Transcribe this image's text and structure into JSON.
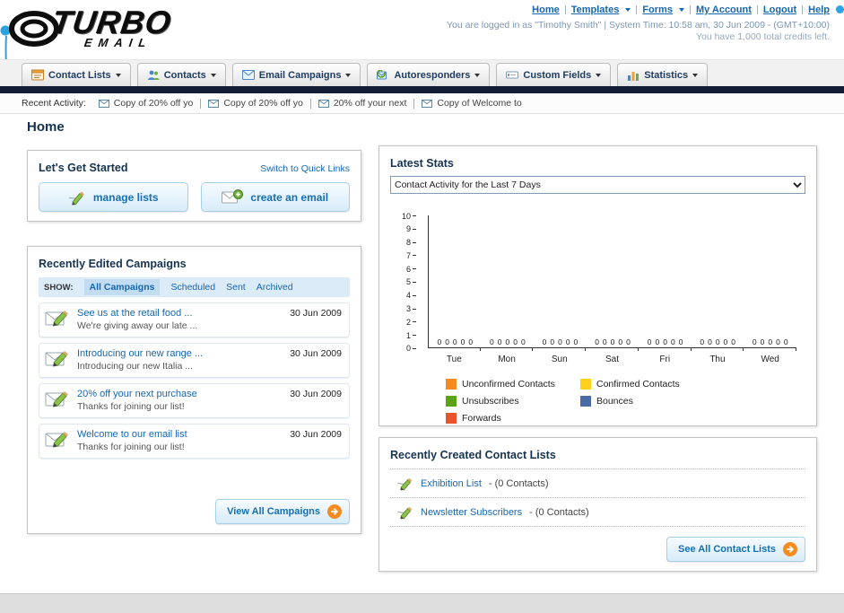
{
  "header": {
    "logo": {
      "line1": "TURBO",
      "line2": "EMAIL"
    },
    "nav": {
      "home": "Home",
      "templates": "Templates",
      "forms": "Forms",
      "my_account": "My Account",
      "logout": "Logout",
      "help": "Help"
    },
    "login_line": "You are logged in as \"Timothy Smith\" | System Time: 10:58 am, 30 Jun 2009 - (GMT+10:00)",
    "credits_line": "You have 1,000 total credits left."
  },
  "tabs": [
    {
      "label": "Contact Lists"
    },
    {
      "label": "Contacts"
    },
    {
      "label": "Email Campaigns"
    },
    {
      "label": "Autoresponders"
    },
    {
      "label": "Custom Fields"
    },
    {
      "label": "Statistics"
    }
  ],
  "recent_activity": {
    "label": "Recent Activity:",
    "items": [
      {
        "text": "Copy of 20% off yo"
      },
      {
        "text": "Copy of 20% off yo"
      },
      {
        "text": "20% off your next"
      },
      {
        "text": "Copy of Welcome to"
      }
    ]
  },
  "page_title": "Home",
  "get_started": {
    "title": "Let's Get Started",
    "switch_link": "Switch to Quick Links",
    "manage_lists": "manage lists",
    "create_email": "create an email"
  },
  "campaigns": {
    "title": "Recently Edited Campaigns",
    "show_label": "SHOW:",
    "filters": [
      {
        "label": "All Campaigns"
      },
      {
        "label": "Scheduled"
      },
      {
        "label": "Sent"
      },
      {
        "label": "Archived"
      }
    ],
    "items": [
      {
        "title": "See us at the retail food ...",
        "subtitle": "We're giving away our late ...",
        "date": "30 Jun 2009"
      },
      {
        "title": "Introducing our new range ...",
        "subtitle": "Introducing our new Italia ...",
        "date": "30 Jun 2009"
      },
      {
        "title": "20% off your next purchase",
        "subtitle": "Thanks for joining our list!",
        "date": "30 Jun 2009"
      },
      {
        "title": "Welcome to our email list",
        "subtitle": "Thanks for joining our list!",
        "date": "30 Jun 2009"
      }
    ],
    "view_all_label": "View All Campaigns"
  },
  "stats": {
    "title": "Latest Stats",
    "selector_value": "Contact Activity for the Last 7 Days"
  },
  "chart_data": {
    "type": "bar",
    "title": "Contact Activity for the Last 7 Days",
    "categories": [
      "Tue",
      "Mon",
      "Sun",
      "Sat",
      "Fri",
      "Thu",
      "Wed"
    ],
    "series": [
      {
        "name": "Unconfirmed Contacts",
        "color": "#f68b1f",
        "values": [
          0,
          0,
          0,
          0,
          0,
          0,
          0
        ]
      },
      {
        "name": "Confirmed Contacts",
        "color": "#ffd11a",
        "values": [
          0,
          0,
          0,
          0,
          0,
          0,
          0
        ]
      },
      {
        "name": "Unsubscribes",
        "color": "#5ca314",
        "values": [
          0,
          0,
          0,
          0,
          0,
          0,
          0
        ]
      },
      {
        "name": "Bounces",
        "color": "#4a69a5",
        "values": [
          0,
          0,
          0,
          0,
          0,
          0,
          0
        ]
      },
      {
        "name": "Forwards",
        "color": "#e8542b",
        "values": [
          0,
          0,
          0,
          0,
          0,
          0,
          0
        ]
      }
    ],
    "ylim": [
      0,
      10
    ],
    "ytick_step": 1,
    "legend_position": "bottom",
    "grid": false
  },
  "contact_lists": {
    "title": "Recently Created Contact Lists",
    "items": [
      {
        "name": "Exhibition List",
        "suffix": "- (0 Contacts)"
      },
      {
        "name": "Newsletter Subscribers",
        "suffix": "- (0 Contacts)"
      }
    ],
    "see_all_label": "See All Contact Lists"
  }
}
